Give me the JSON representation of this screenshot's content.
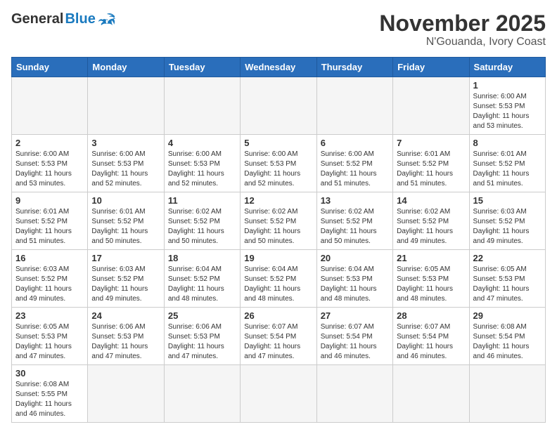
{
  "header": {
    "logo_general": "General",
    "logo_blue": "Blue",
    "title": "November 2025",
    "subtitle": "N'Gouanda, Ivory Coast"
  },
  "calendar": {
    "days_of_week": [
      "Sunday",
      "Monday",
      "Tuesday",
      "Wednesday",
      "Thursday",
      "Friday",
      "Saturday"
    ],
    "weeks": [
      {
        "days": [
          {
            "num": "",
            "info": ""
          },
          {
            "num": "",
            "info": ""
          },
          {
            "num": "",
            "info": ""
          },
          {
            "num": "",
            "info": ""
          },
          {
            "num": "",
            "info": ""
          },
          {
            "num": "",
            "info": ""
          },
          {
            "num": "1",
            "info": "Sunrise: 6:00 AM\nSunset: 5:53 PM\nDaylight: 11 hours\nand 53 minutes."
          }
        ]
      },
      {
        "days": [
          {
            "num": "2",
            "info": "Sunrise: 6:00 AM\nSunset: 5:53 PM\nDaylight: 11 hours\nand 53 minutes."
          },
          {
            "num": "3",
            "info": "Sunrise: 6:00 AM\nSunset: 5:53 PM\nDaylight: 11 hours\nand 52 minutes."
          },
          {
            "num": "4",
            "info": "Sunrise: 6:00 AM\nSunset: 5:53 PM\nDaylight: 11 hours\nand 52 minutes."
          },
          {
            "num": "5",
            "info": "Sunrise: 6:00 AM\nSunset: 5:53 PM\nDaylight: 11 hours\nand 52 minutes."
          },
          {
            "num": "6",
            "info": "Sunrise: 6:00 AM\nSunset: 5:52 PM\nDaylight: 11 hours\nand 51 minutes."
          },
          {
            "num": "7",
            "info": "Sunrise: 6:01 AM\nSunset: 5:52 PM\nDaylight: 11 hours\nand 51 minutes."
          },
          {
            "num": "8",
            "info": "Sunrise: 6:01 AM\nSunset: 5:52 PM\nDaylight: 11 hours\nand 51 minutes."
          }
        ]
      },
      {
        "days": [
          {
            "num": "9",
            "info": "Sunrise: 6:01 AM\nSunset: 5:52 PM\nDaylight: 11 hours\nand 51 minutes."
          },
          {
            "num": "10",
            "info": "Sunrise: 6:01 AM\nSunset: 5:52 PM\nDaylight: 11 hours\nand 50 minutes."
          },
          {
            "num": "11",
            "info": "Sunrise: 6:02 AM\nSunset: 5:52 PM\nDaylight: 11 hours\nand 50 minutes."
          },
          {
            "num": "12",
            "info": "Sunrise: 6:02 AM\nSunset: 5:52 PM\nDaylight: 11 hours\nand 50 minutes."
          },
          {
            "num": "13",
            "info": "Sunrise: 6:02 AM\nSunset: 5:52 PM\nDaylight: 11 hours\nand 50 minutes."
          },
          {
            "num": "14",
            "info": "Sunrise: 6:02 AM\nSunset: 5:52 PM\nDaylight: 11 hours\nand 49 minutes."
          },
          {
            "num": "15",
            "info": "Sunrise: 6:03 AM\nSunset: 5:52 PM\nDaylight: 11 hours\nand 49 minutes."
          }
        ]
      },
      {
        "days": [
          {
            "num": "16",
            "info": "Sunrise: 6:03 AM\nSunset: 5:52 PM\nDaylight: 11 hours\nand 49 minutes."
          },
          {
            "num": "17",
            "info": "Sunrise: 6:03 AM\nSunset: 5:52 PM\nDaylight: 11 hours\nand 49 minutes."
          },
          {
            "num": "18",
            "info": "Sunrise: 6:04 AM\nSunset: 5:52 PM\nDaylight: 11 hours\nand 48 minutes."
          },
          {
            "num": "19",
            "info": "Sunrise: 6:04 AM\nSunset: 5:52 PM\nDaylight: 11 hours\nand 48 minutes."
          },
          {
            "num": "20",
            "info": "Sunrise: 6:04 AM\nSunset: 5:53 PM\nDaylight: 11 hours\nand 48 minutes."
          },
          {
            "num": "21",
            "info": "Sunrise: 6:05 AM\nSunset: 5:53 PM\nDaylight: 11 hours\nand 48 minutes."
          },
          {
            "num": "22",
            "info": "Sunrise: 6:05 AM\nSunset: 5:53 PM\nDaylight: 11 hours\nand 47 minutes."
          }
        ]
      },
      {
        "days": [
          {
            "num": "23",
            "info": "Sunrise: 6:05 AM\nSunset: 5:53 PM\nDaylight: 11 hours\nand 47 minutes."
          },
          {
            "num": "24",
            "info": "Sunrise: 6:06 AM\nSunset: 5:53 PM\nDaylight: 11 hours\nand 47 minutes."
          },
          {
            "num": "25",
            "info": "Sunrise: 6:06 AM\nSunset: 5:53 PM\nDaylight: 11 hours\nand 47 minutes."
          },
          {
            "num": "26",
            "info": "Sunrise: 6:07 AM\nSunset: 5:54 PM\nDaylight: 11 hours\nand 47 minutes."
          },
          {
            "num": "27",
            "info": "Sunrise: 6:07 AM\nSunset: 5:54 PM\nDaylight: 11 hours\nand 46 minutes."
          },
          {
            "num": "28",
            "info": "Sunrise: 6:07 AM\nSunset: 5:54 PM\nDaylight: 11 hours\nand 46 minutes."
          },
          {
            "num": "29",
            "info": "Sunrise: 6:08 AM\nSunset: 5:54 PM\nDaylight: 11 hours\nand 46 minutes."
          }
        ]
      },
      {
        "days": [
          {
            "num": "30",
            "info": "Sunrise: 6:08 AM\nSunset: 5:55 PM\nDaylight: 11 hours\nand 46 minutes."
          },
          {
            "num": "",
            "info": ""
          },
          {
            "num": "",
            "info": ""
          },
          {
            "num": "",
            "info": ""
          },
          {
            "num": "",
            "info": ""
          },
          {
            "num": "",
            "info": ""
          },
          {
            "num": "",
            "info": ""
          }
        ]
      }
    ]
  }
}
